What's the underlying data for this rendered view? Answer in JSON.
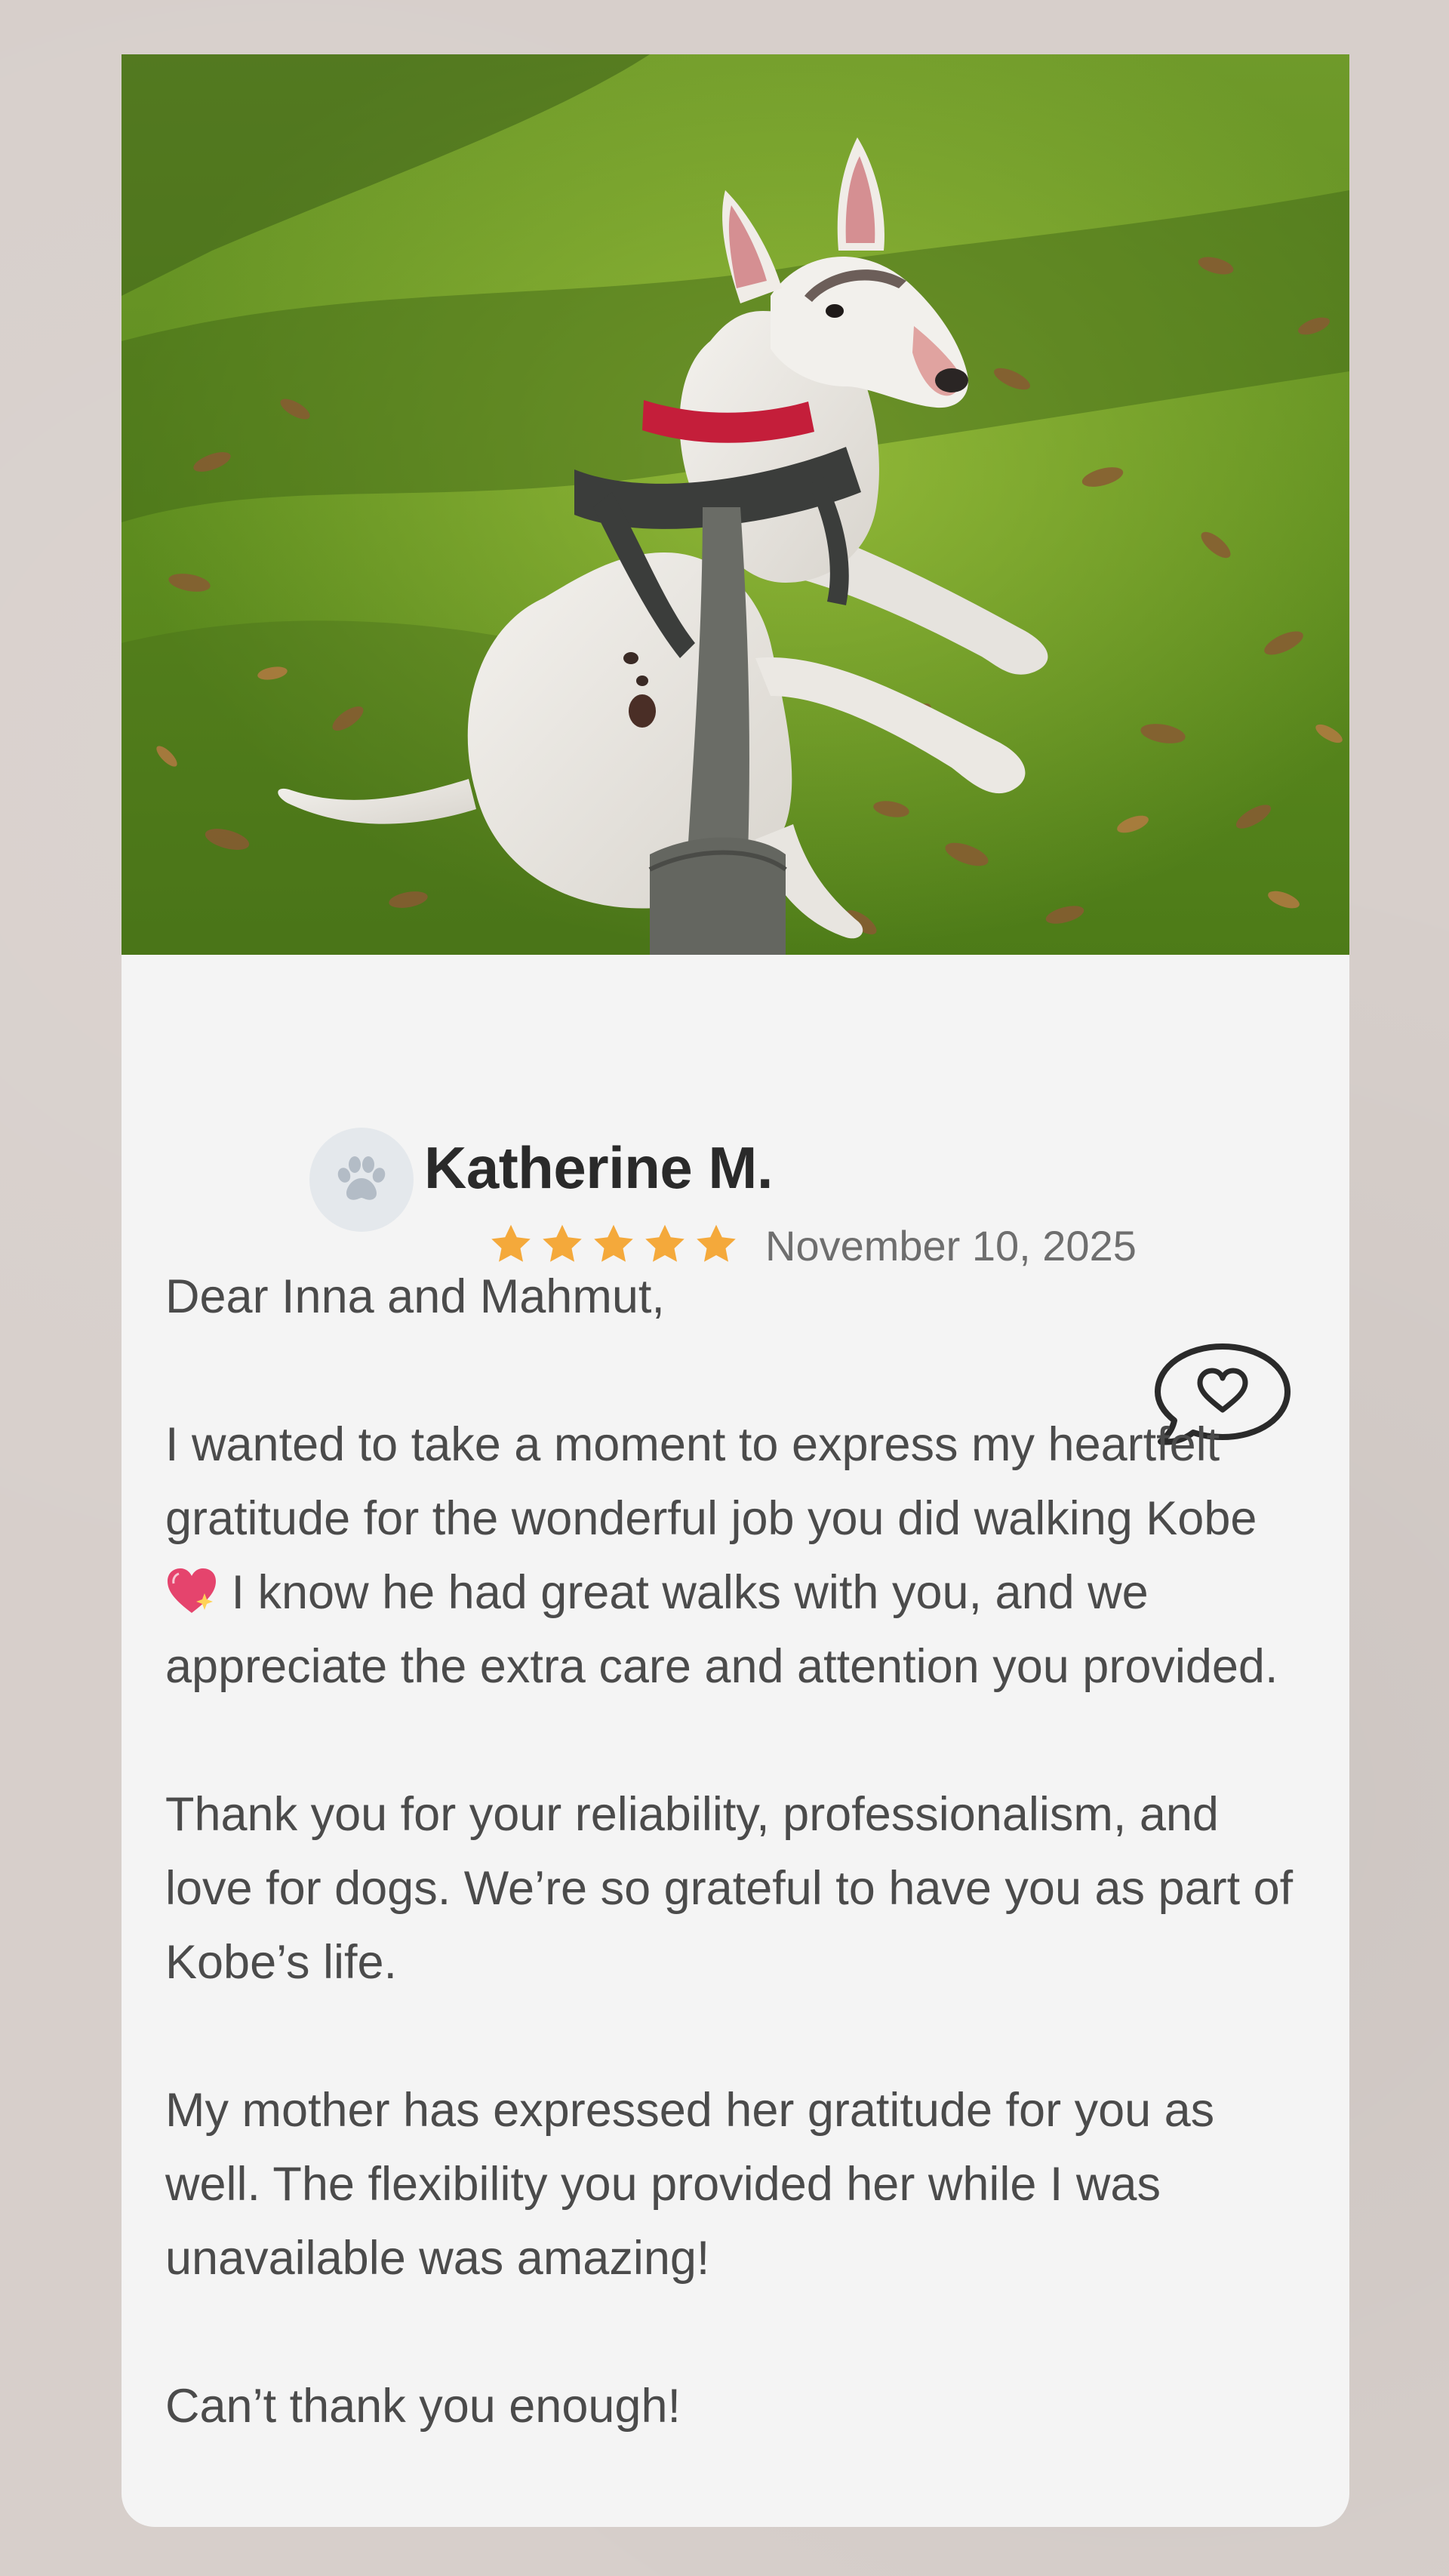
{
  "reviewer": {
    "name": "Katherine M.",
    "date": "November 10, 2025",
    "rating": 5,
    "avatar_icon": "paw-icon"
  },
  "photo": {
    "icon": "dog-photo"
  },
  "message": {
    "greeting": "Dear Inna and Mahmut,",
    "p1_before_emoji": "I wanted to take a moment to express my heartfelt gratitude for the wonderful job you did walking Kobe",
    "p1_after_emoji": "I know he had great walks with you, and we appreciate the extra care and attention you provided.",
    "p2": "Thank you for your reliability, professionalism, and love for dogs. We’re so grateful to have you as part of Kobe’s life.",
    "p3": "My mother has expressed her gratitude for you as well. The flexibility you provided her while I was unavailable was amazing!",
    "closing": "Can’t thank you enough!",
    "emoji_icon": "sparkling-heart-icon",
    "bubble_icon": "speech-bubble-heart-icon"
  },
  "colors": {
    "background": "#d7cfcb",
    "card": "#f4f4f4",
    "star": "#f4a93b",
    "name": "#2a2a2a",
    "body_text": "#4b4b4b",
    "date_text": "#6e6e6e",
    "heart_emoji": "#e5446d"
  }
}
